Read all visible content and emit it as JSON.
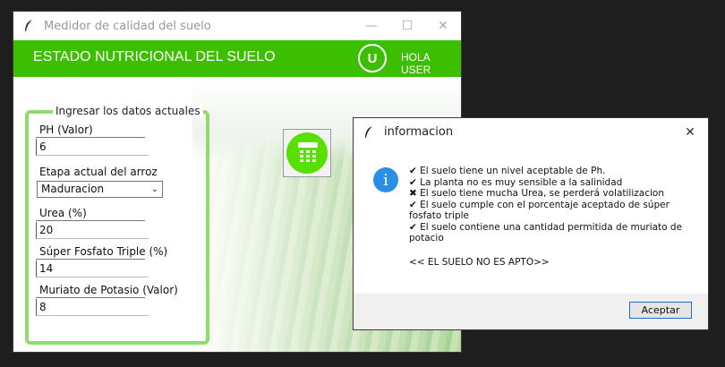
{
  "main_window": {
    "title": "Medidor de calidad del suelo",
    "controls": {
      "minimize": "—",
      "maximize": "☐",
      "close": "✕"
    }
  },
  "header": {
    "title": "ESTADO NUTRICIONAL DEL SUELO",
    "avatar_letter": "U",
    "greeting": "HOLA USER",
    "color": "#3cbf00"
  },
  "form": {
    "group_label": "Ingresar los datos actuales",
    "fields": [
      {
        "label": "PH (Valor)",
        "value": "6"
      },
      {
        "label": "Etapa actual del arroz",
        "value": "Maduracion"
      },
      {
        "label": "Urea (%)",
        "value": "20"
      },
      {
        "label": "Súper Fosfato Triple (%)",
        "value": "14"
      },
      {
        "label": "Muriato de Potasio (Valor)",
        "value": "8"
      }
    ],
    "border_color": "#8fdc6a"
  },
  "calc_button": {
    "icon": "calculator-icon",
    "color": "#57e000"
  },
  "dialog": {
    "title": "informacion",
    "close": "✕",
    "lines": [
      "✔ El suelo tiene un nivel aceptable de Ph.",
      "✔ La planta no es muy sensible a la salinidad",
      "✖ El suelo tiene mucha Urea, se perderá volatilizacion",
      "✔ El suelo cumple con el porcentaje aceptado de súper fosfato triple",
      "✔ El suelo contiene una cantidad permitida de muriato de potacio"
    ],
    "verdict": "<< EL SUELO NO ES APTO>>",
    "button": "Aceptar",
    "info_icon": "i"
  }
}
